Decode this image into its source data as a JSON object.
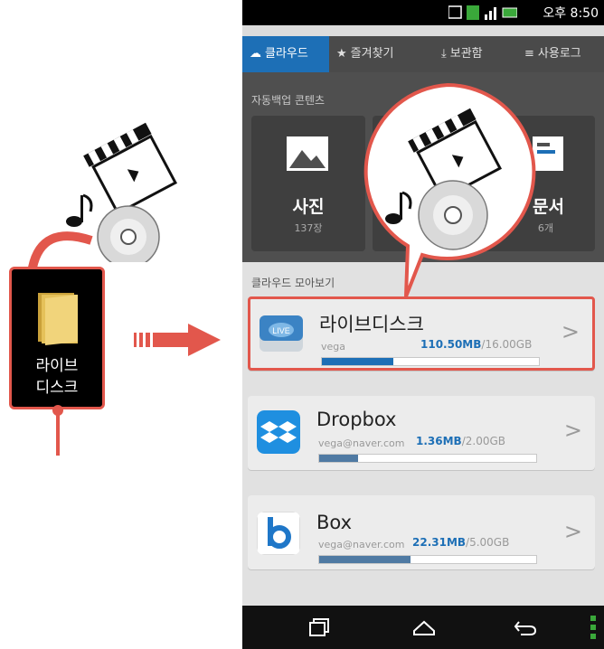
{
  "illustration": {
    "folder_label_line1": "라이브",
    "folder_label_line2": "디스크"
  },
  "status_bar": {
    "time": "오후 8:50"
  },
  "tabs": [
    {
      "label": "클라우드",
      "icon": "cloud-icon",
      "active": true
    },
    {
      "label": "즐겨찾기",
      "icon": "star-icon",
      "active": false
    },
    {
      "label": "보관함",
      "icon": "download-icon",
      "active": false
    },
    {
      "label": "사용로그",
      "icon": "list-icon",
      "active": false
    }
  ],
  "auto_backup": {
    "title": "자동백업 콘텐츠",
    "cards": [
      {
        "label": "사진",
        "count": "137장",
        "icon": "photo-icon"
      },
      {
        "label": "문서",
        "count": "6개",
        "icon": "document-icon"
      }
    ]
  },
  "cloud_overview": {
    "title": "클라우드 모아보기",
    "services": [
      {
        "name": "라이브디스크",
        "account": "vega",
        "used": "110.50MB",
        "total": "/16.00GB",
        "fill": 0.33,
        "icon": "live-disk-icon",
        "selected": true
      },
      {
        "name": "Dropbox",
        "account": "vega@naver.com",
        "used": "1.36MB",
        "total": "/2.00GB",
        "fill": 0.18,
        "icon": "dropbox-icon",
        "selected": false
      },
      {
        "name": "Box",
        "account": "vega@naver.com",
        "used": "22.31MB",
        "total": "/5.00GB",
        "fill": 0.42,
        "icon": "box-icon",
        "selected": false
      }
    ]
  },
  "colors": {
    "accent": "#1d6fb6",
    "highlight": "#e2574c"
  }
}
